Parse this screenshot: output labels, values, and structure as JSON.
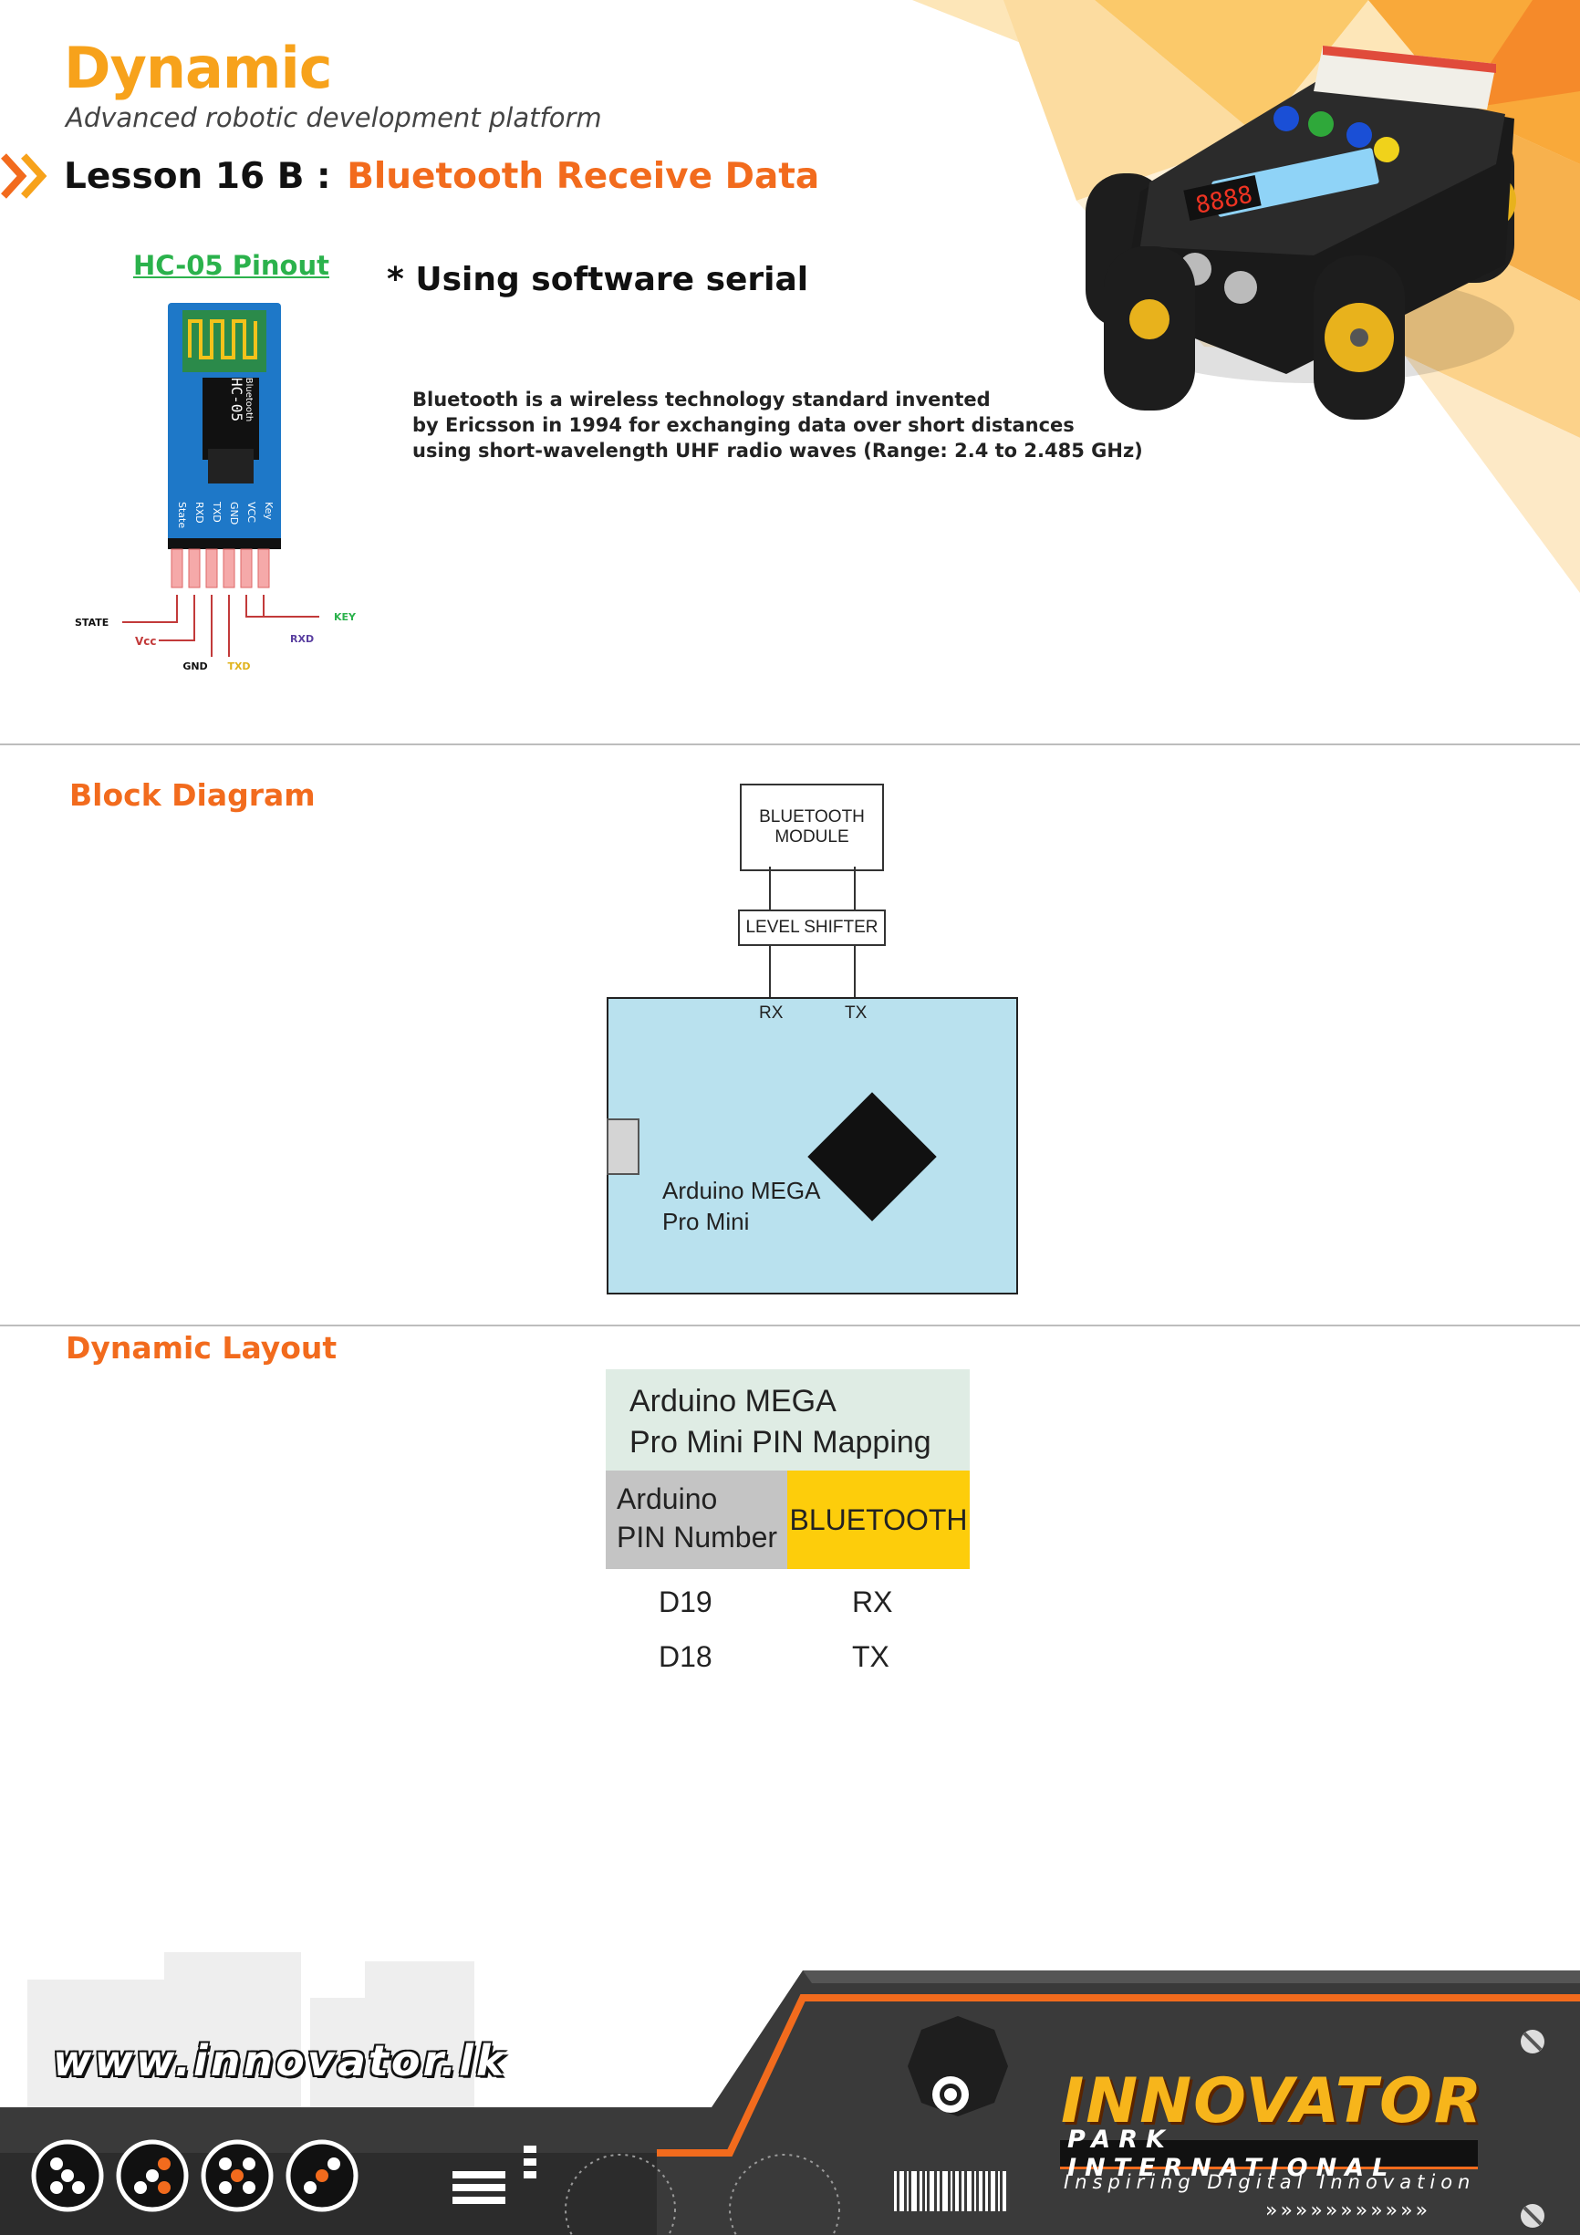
{
  "header": {
    "brand": "Dynamic",
    "tagline": "Advanced robotic development platform",
    "lesson_label": "Lesson 16 B : ",
    "lesson_title": "Bluetooth Receive Data"
  },
  "pinout": {
    "title": "HC-05 Pinout",
    "module_label": "HC-05",
    "module_sub": "Bluetooth",
    "pins_printed": [
      "State",
      "RXD",
      "TXD",
      "GND",
      "VCC",
      "Key"
    ],
    "callouts": {
      "state": "STATE",
      "vcc": "Vcc",
      "gnd": "GND",
      "txd": "TXD",
      "rxd": "RXD",
      "key": "KEY"
    }
  },
  "intro": {
    "software_note": "* Using software serial",
    "description_lines": [
      "Bluetooth is a wireless technology standard invented",
      "by Ericsson in 1994 for exchanging data over short distances",
      "using short-wavelength UHF radio waves (Range: 2.4 to 2.485 GHz)"
    ]
  },
  "block_diagram": {
    "title": "Block Diagram",
    "bt_module_line1": "BLUETOOTH",
    "bt_module_line2": "MODULE",
    "level_shifter": "LEVEL SHIFTER",
    "rx": "RX",
    "tx": "TX",
    "board_line1": "Arduino MEGA",
    "board_line2": "Pro Mini"
  },
  "layout": {
    "title": "Dynamic Layout",
    "table_title_line1": "Arduino MEGA",
    "table_title_line2": "Pro Mini PIN Mapping",
    "col_a_line1": "Arduino",
    "col_a_line2": "PIN Number",
    "col_b": "BLUETOOTH",
    "rows": [
      {
        "pin": "D19",
        "bt": "RX"
      },
      {
        "pin": "D18",
        "bt": "TX"
      }
    ]
  },
  "footer": {
    "website": "www.innovator.lk",
    "logo_main": "INNOVATOR",
    "logo_sub": "PARK INTERNATIONAL",
    "logo_tagline": "Inspiring Digital Innovation"
  },
  "colors": {
    "brand_orange": "#f26b1d",
    "brand_yellow": "#f7a21b",
    "pinout_green": "#2bb24c",
    "board_blue": "#b9e1ee",
    "table_header": "#dfece4",
    "table_col_a": "#c4c4c4",
    "table_col_b": "#fdcd0b",
    "footer_dark": "#3a3a3a"
  }
}
